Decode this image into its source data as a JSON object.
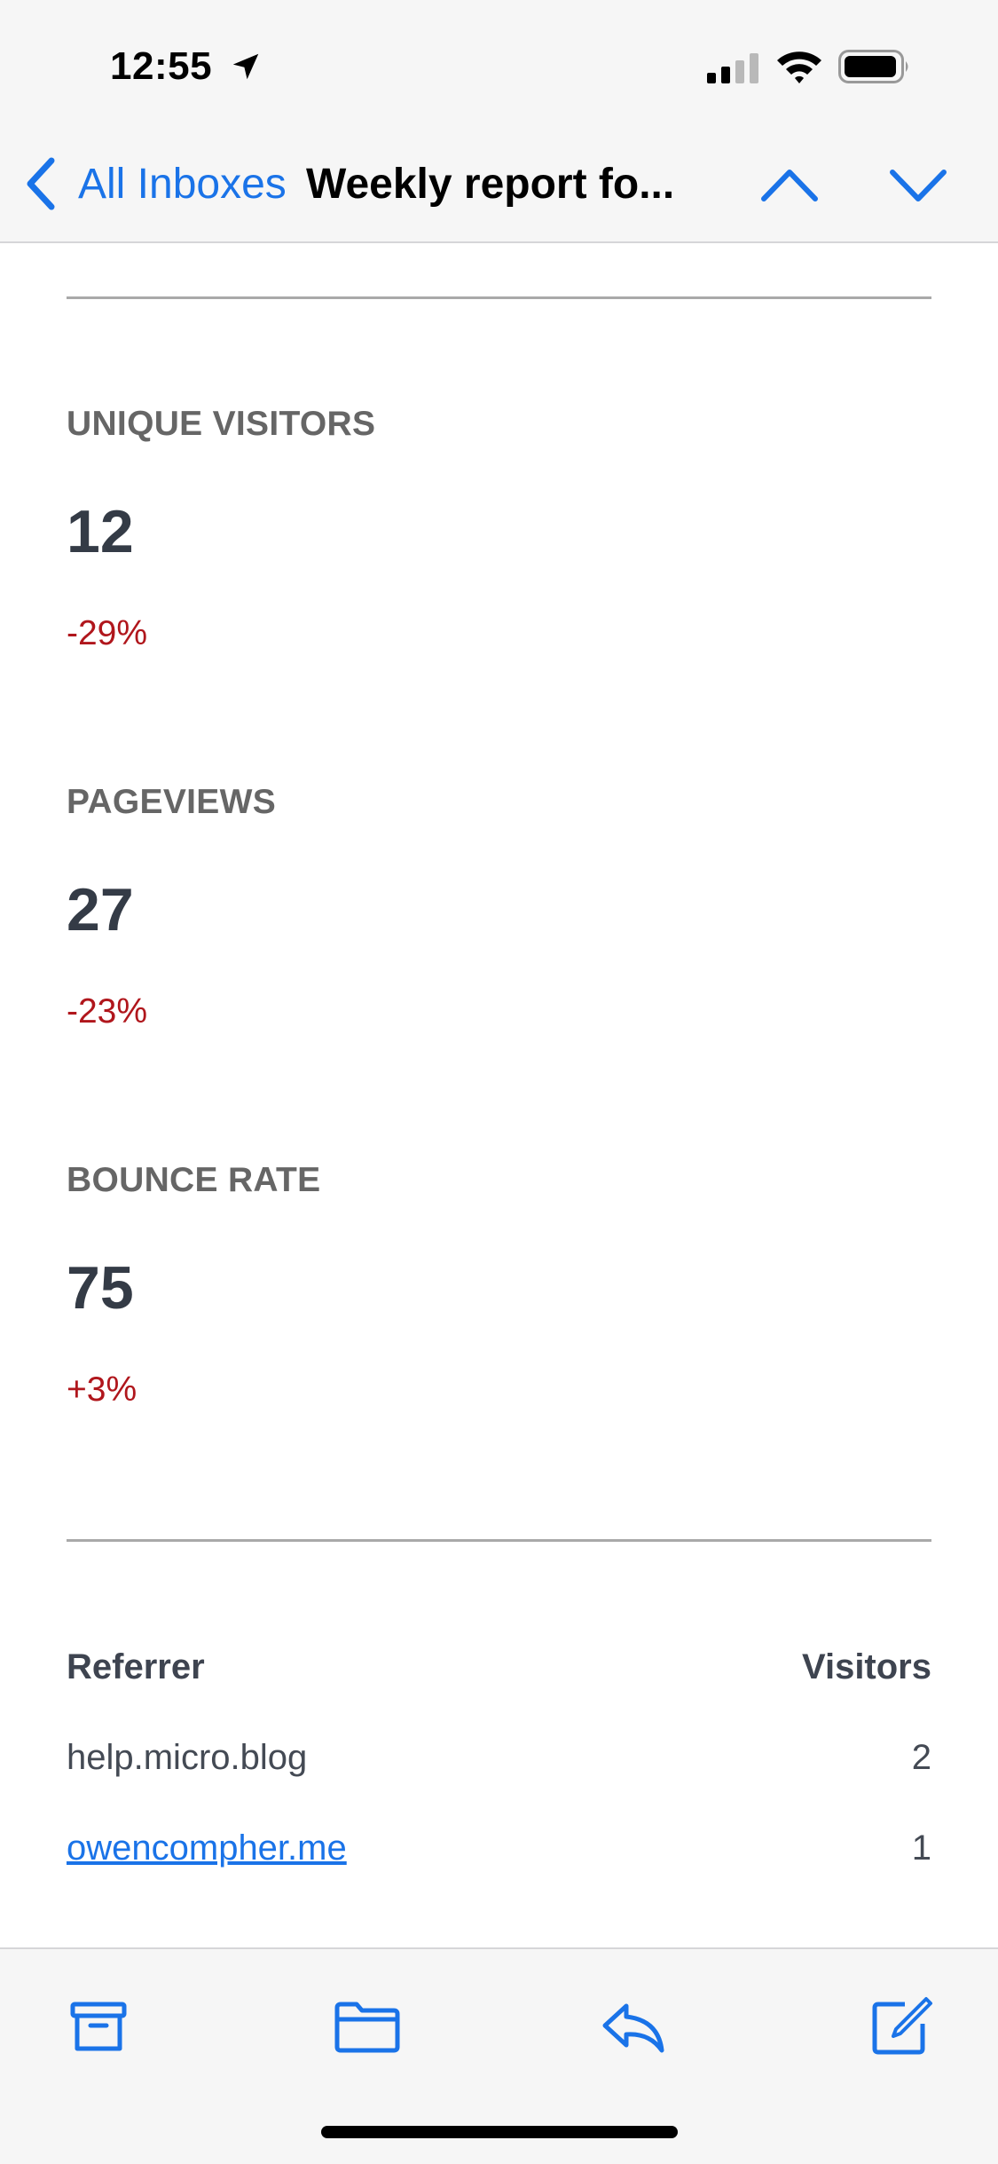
{
  "status_bar": {
    "time": "12:55"
  },
  "nav": {
    "back_label": "All Inboxes",
    "title": "Weekly report fo..."
  },
  "metrics": [
    {
      "label": "UNIQUE VISITORS",
      "value": "12",
      "change": "-29%"
    },
    {
      "label": "PAGEVIEWS",
      "value": "27",
      "change": "-23%"
    },
    {
      "label": "BOUNCE RATE",
      "value": "75",
      "change": "+3%"
    }
  ],
  "referrers": {
    "headers": {
      "referrer": "Referrer",
      "visitors": "Visitors"
    },
    "rows": [
      {
        "referrer": "help.micro.blog",
        "visitors": "2",
        "is_link": false
      },
      {
        "referrer": "owencompher.me",
        "visitors": "1",
        "is_link": true
      }
    ]
  },
  "colors": {
    "accent": "#1a73e8",
    "negative": "#b0161c",
    "label_gray": "#666666",
    "value_dark": "#343b46"
  },
  "icons": {
    "toolbar": [
      "archive-icon",
      "folder-icon",
      "reply-icon",
      "compose-icon"
    ]
  }
}
